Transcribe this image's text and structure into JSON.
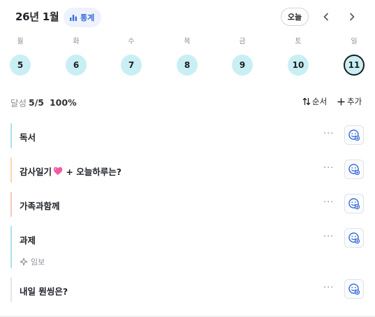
{
  "header": {
    "month": "26년 1월",
    "stats_label": "통계",
    "today_label": "오늘",
    "prev_icon": "chevron-left-icon",
    "next_icon": "chevron-right-icon"
  },
  "week": {
    "days": [
      {
        "label": "월",
        "date": "5"
      },
      {
        "label": "화",
        "date": "6"
      },
      {
        "label": "수",
        "date": "7"
      },
      {
        "label": "목",
        "date": "8"
      },
      {
        "label": "금",
        "date": "9"
      },
      {
        "label": "토",
        "date": "10"
      },
      {
        "label": "일",
        "date": "11",
        "selected": true
      }
    ],
    "circle_color": "#c9eff4"
  },
  "summary": {
    "label": "달성",
    "count": "5/5",
    "percent": "100%",
    "sort_label": "순서",
    "add_label": "추가"
  },
  "habits": [
    {
      "title": "독서",
      "color": "#a7e3ea"
    },
    {
      "title": "감사일기",
      "title_suffix": " + 오늘하루는?",
      "emoji_icon": "heart-icon",
      "color": "#fbd7a8"
    },
    {
      "title": "가족과함께",
      "color": "#f8c6c0"
    },
    {
      "title": "과제",
      "sub": "임보",
      "color": "#a7e3ea"
    },
    {
      "title": "내일 뭔씽은?",
      "color": "#e3e6ea"
    }
  ],
  "colors": {
    "accent": "#3b6fd8",
    "muted": "#8a9099"
  }
}
